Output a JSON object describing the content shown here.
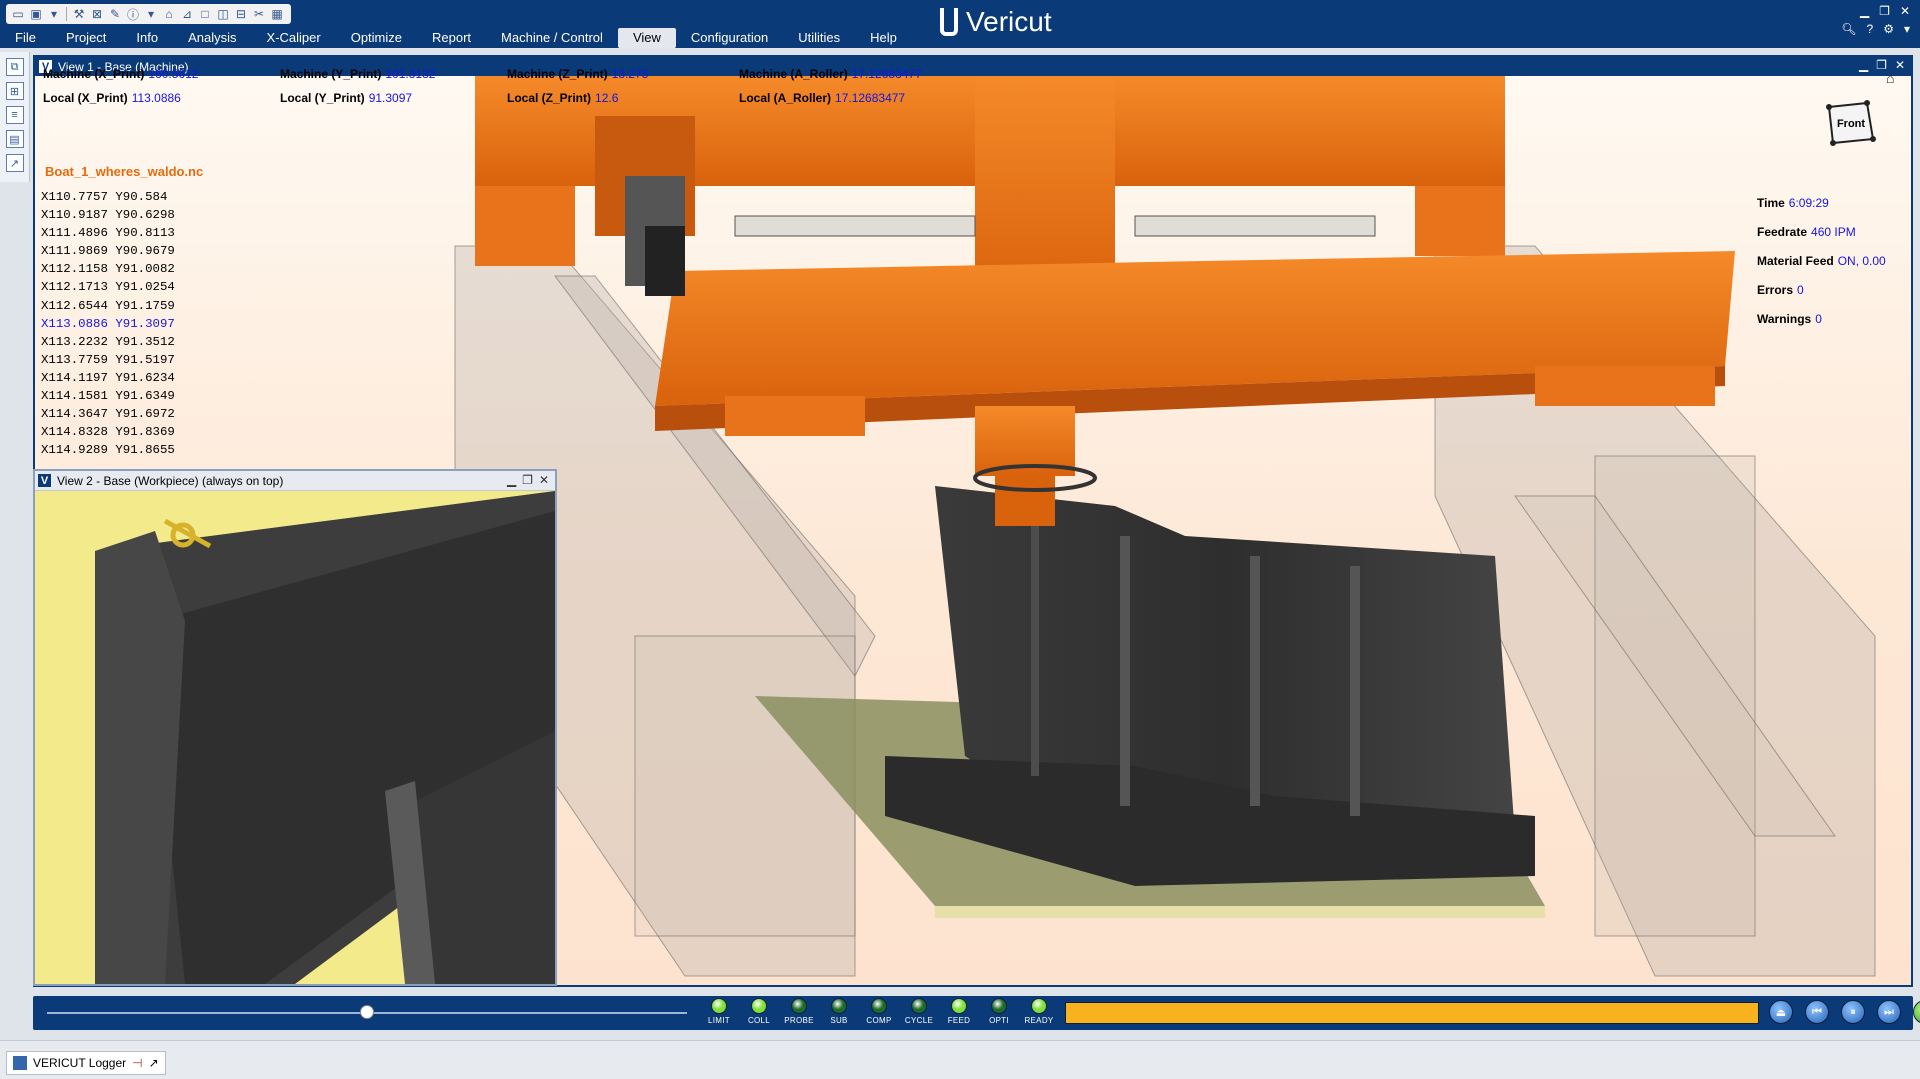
{
  "app": {
    "brand": "Vericut"
  },
  "menu": [
    "File",
    "Project",
    "Info",
    "Analysis",
    "X-Caliper",
    "Optimize",
    "Report",
    "Machine / Control",
    "View",
    "Configuration",
    "Utilities",
    "Help"
  ],
  "menu_active": "View",
  "view1": {
    "title": "View 1 - Base (Machine)",
    "readouts": {
      "machine_x": {
        "label": "Machine (X_Print)",
        "value": "160.5612"
      },
      "machine_y": {
        "label": "Machine (Y_Print)",
        "value": "101.3132"
      },
      "machine_z": {
        "label": "Machine (Z_Print)",
        "value": "13.275"
      },
      "machine_a": {
        "label": "Machine (A_Roller)",
        "value": "17.12683477"
      },
      "local_x": {
        "label": "Local (X_Print)",
        "value": "113.0886"
      },
      "local_y": {
        "label": "Local (Y_Print)",
        "value": "91.3097"
      },
      "local_z": {
        "label": "Local (Z_Print)",
        "value": "12.6"
      },
      "local_a": {
        "label": "Local (A_Roller)",
        "value": "17.12683477"
      }
    },
    "nc_file": "Boat_1_wheres_waldo.nc",
    "nc_lines": [
      {
        "text": "X110.7757 Y90.584",
        "current": false
      },
      {
        "text": "X110.9187 Y90.6298",
        "current": false
      },
      {
        "text": "X111.4896 Y90.8113",
        "current": false
      },
      {
        "text": "X111.9869 Y90.9679",
        "current": false
      },
      {
        "text": "X112.1158 Y91.0082",
        "current": false
      },
      {
        "text": "X112.1713 Y91.0254",
        "current": false
      },
      {
        "text": "X112.6544 Y91.1759",
        "current": false
      },
      {
        "text": "X113.0886 Y91.3097",
        "current": true
      },
      {
        "text": "X113.2232 Y91.3512",
        "current": false
      },
      {
        "text": "X113.7759 Y91.5197",
        "current": false
      },
      {
        "text": "X114.1197 Y91.6234",
        "current": false
      },
      {
        "text": "X114.1581 Y91.6349",
        "current": false
      },
      {
        "text": "X114.3647 Y91.6972",
        "current": false
      },
      {
        "text": "X114.8328 Y91.8369",
        "current": false
      },
      {
        "text": "X114.9289 Y91.8655",
        "current": false
      }
    ],
    "view_cube_label": "Front",
    "stats": {
      "time": {
        "label": "Time",
        "value": "6:09:29"
      },
      "feedrate": {
        "label": "Feedrate",
        "value": "460 IPM"
      },
      "material_feed": {
        "label": "Material Feed",
        "value": "ON, 0.00"
      },
      "errors": {
        "label": "Errors",
        "value": "0"
      },
      "warnings": {
        "label": "Warnings",
        "value": "0"
      }
    }
  },
  "view2": {
    "title": "View 2 - Base (Workpiece) (always on top)"
  },
  "playback": {
    "slider_fraction": 0.5,
    "progress_fraction": 1.0,
    "leds": [
      {
        "label": "LIMIT",
        "color": "#7fe03a"
      },
      {
        "label": "COLL",
        "color": "#7fe03a"
      },
      {
        "label": "PROBE",
        "color": "#1f6b2a"
      },
      {
        "label": "SUB",
        "color": "#1f6b2a"
      },
      {
        "label": "COMP",
        "color": "#1f6b2a"
      },
      {
        "label": "CYCLE",
        "color": "#1f6b2a"
      },
      {
        "label": "FEED",
        "color": "#7fe03a"
      },
      {
        "label": "OPTI",
        "color": "#1f6b2a"
      },
      {
        "label": "READY",
        "color": "#7fe03a"
      }
    ],
    "buttons": [
      "reset-icon",
      "step-back-icon",
      "pause-icon",
      "step-forward-icon",
      "play-icon"
    ]
  },
  "taskbar": {
    "logger_label": "VERICUT Logger"
  },
  "colors": {
    "accent": "#0b3a78",
    "machine_orange": "#f07a1a",
    "highlight_value": "#1515e0",
    "nc_file": "#e46b10",
    "progress": "#f7b21e"
  }
}
